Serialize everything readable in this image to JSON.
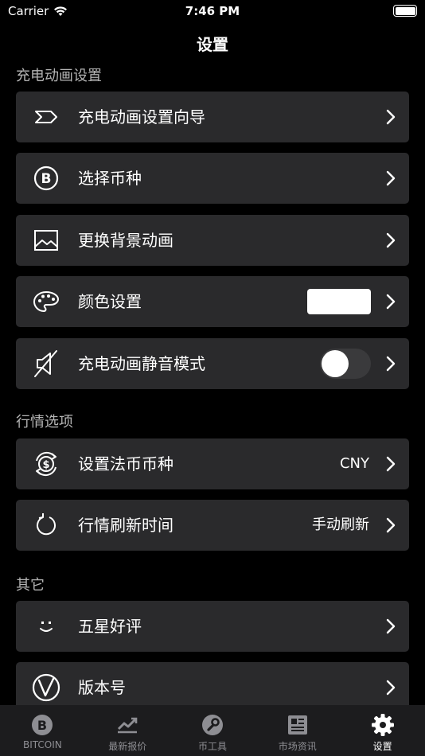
{
  "status_bar": {
    "carrier": "Carrier",
    "time": "7:46 PM"
  },
  "nav": {
    "title": "设置"
  },
  "sections": [
    {
      "header": "充电动画设置"
    },
    {
      "header": "行情选项"
    },
    {
      "header": "其它"
    }
  ],
  "rows": {
    "wizard": {
      "label": "充电动画设置向导",
      "icon": "arrow-chevron-icon"
    },
    "coin": {
      "label": "选择币种",
      "icon": "bitcoin-icon"
    },
    "background": {
      "label": "更换背景动画",
      "icon": "image-icon"
    },
    "color": {
      "label": "颜色设置",
      "icon": "palette-icon",
      "swatch_color": "#ffffff"
    },
    "mute": {
      "label": "充电动画静音模式",
      "icon": "mute-icon",
      "toggle_on": false
    },
    "fiat": {
      "label": "设置法币币种",
      "value": "CNY",
      "icon": "currency-exchange-icon"
    },
    "refresh": {
      "label": "行情刷新时间",
      "value": "手动刷新",
      "icon": "refresh-icon"
    },
    "rating": {
      "label": "五星好评",
      "icon": "smile-icon"
    },
    "version": {
      "label": "版本号",
      "icon": "version-icon"
    }
  },
  "tabs": [
    {
      "label": "BITCOIN",
      "icon": "bitcoin-tab-icon"
    },
    {
      "label": "最新报价",
      "icon": "chart-tab-icon"
    },
    {
      "label": "币工具",
      "icon": "wrench-tab-icon"
    },
    {
      "label": "市场资讯",
      "icon": "news-tab-icon"
    },
    {
      "label": "设置",
      "icon": "gear-tab-icon",
      "active": true
    }
  ]
}
